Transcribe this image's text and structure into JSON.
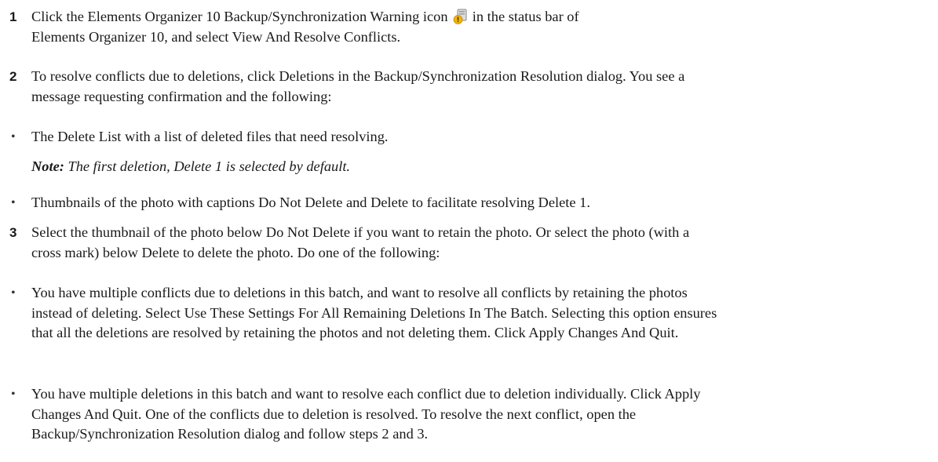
{
  "steps": [
    {
      "marker": "1",
      "lines": [
        {
          "before": "Click the Elements Organizer 10 Backup/Synchronization Warning icon",
          "icon": "backup-warning-icon",
          "after": "in the status bar of"
        },
        {
          "text": "Elements Organizer 10, and select View And Resolve Conflicts."
        }
      ]
    },
    {
      "marker": "2",
      "lines": [
        "To resolve conflicts due to deletions, click Deletions in the Backup/Synchronization Resolution dialog. You see a",
        "message requesting confirmation and the following:"
      ]
    },
    {
      "marker": "•",
      "lines": [
        "The Delete List with a list of deleted files that need resolving."
      ]
    },
    {
      "note_label": "Note:",
      "note_body": " The first deletion, Delete 1 is selected by default."
    },
    {
      "marker": "•",
      "lines": [
        "Thumbnails of the photo with captions Do Not Delete and Delete to facilitate resolving Delete 1."
      ]
    },
    {
      "marker": "3",
      "lines": [
        "Select the thumbnail of the photo below Do Not Delete if you want to retain the photo. Or select the photo (with a",
        "cross mark) below Delete to delete the photo. Do one of the following:"
      ]
    },
    {
      "marker": "•",
      "lines": [
        "You have multiple conflicts due to deletions in this batch, and want to resolve all conflicts by retaining the photos",
        "instead of deleting. Select Use These Settings For All Remaining Deletions In The Batch. Selecting this option ensures",
        "that all the deletions are resolved by retaining the photos and not deleting them. Click Apply Changes And Quit."
      ]
    },
    {
      "marker": "•",
      "lines": [
        "You have multiple deletions in this batch and want to resolve each conflict due to deletion individually. Click Apply",
        "Changes And Quit. One of the conflicts due to deletion is resolved. To resolve the next conflict, open the",
        "Backup/Synchronization Resolution dialog and follow steps 2 and 3."
      ]
    }
  ]
}
